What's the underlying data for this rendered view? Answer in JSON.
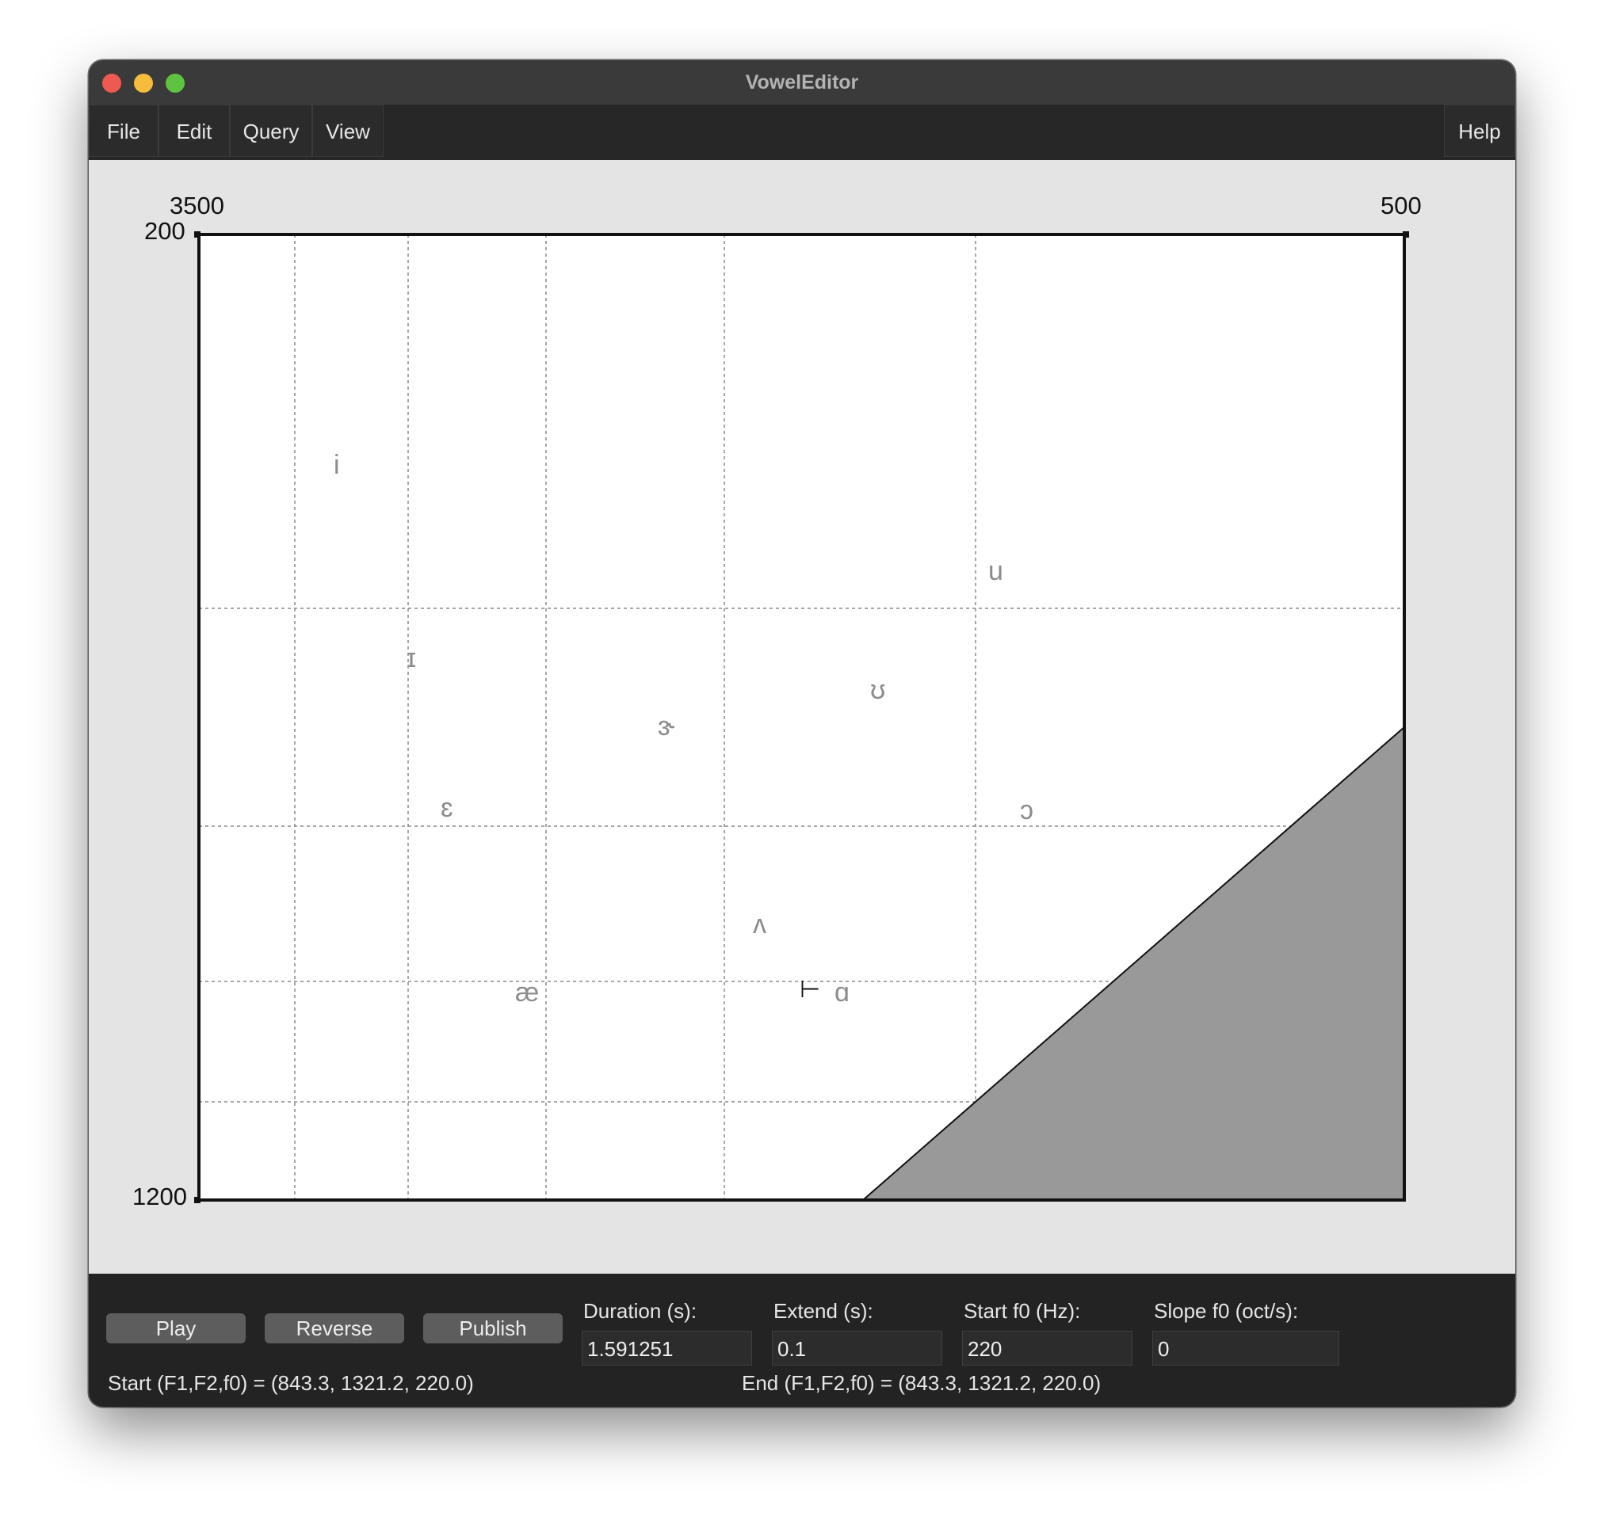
{
  "window": {
    "title": "VowelEditor"
  },
  "menu": {
    "file": "File",
    "edit": "Edit",
    "query": "Query",
    "view": "View",
    "help": "Help"
  },
  "plot": {
    "f2_left_label": "3500",
    "f2_right_label": "500",
    "f1_top_label": "200",
    "f1_bottom_label": "1200",
    "vowels": {
      "i": "i",
      "u": "u",
      "ih": "ɪ",
      "uh": "ʊ",
      "er": "ɝ",
      "eh": "ɛ",
      "aw": "ɔ",
      "uh2": "ʌ",
      "ae": "æ",
      "aa": "ɑ"
    },
    "marker": "⊢"
  },
  "controls": {
    "play_label": "Play",
    "reverse_label": "Reverse",
    "publish_label": "Publish",
    "duration_label": "Duration (s):",
    "duration_value": "1.591251",
    "extend_label": "Extend (s):",
    "extend_value": "0.1",
    "start_f0_label": "Start f0 (Hz):",
    "start_f0_value": "220",
    "slope_f0_label": "Slope f0 (oct/s):",
    "slope_f0_value": "0"
  },
  "status": {
    "start": "Start (F1,F2,f0) = (843.3, 1321.2, 220.0)",
    "end": "End (F1,F2,f0) = (843.3, 1321.2, 220.0)"
  },
  "colors": {
    "plot_background": "#ffffff",
    "forbidden_region": "#999999",
    "vowel_text": "#8c8c8c",
    "bottom_panel": "#232323"
  }
}
